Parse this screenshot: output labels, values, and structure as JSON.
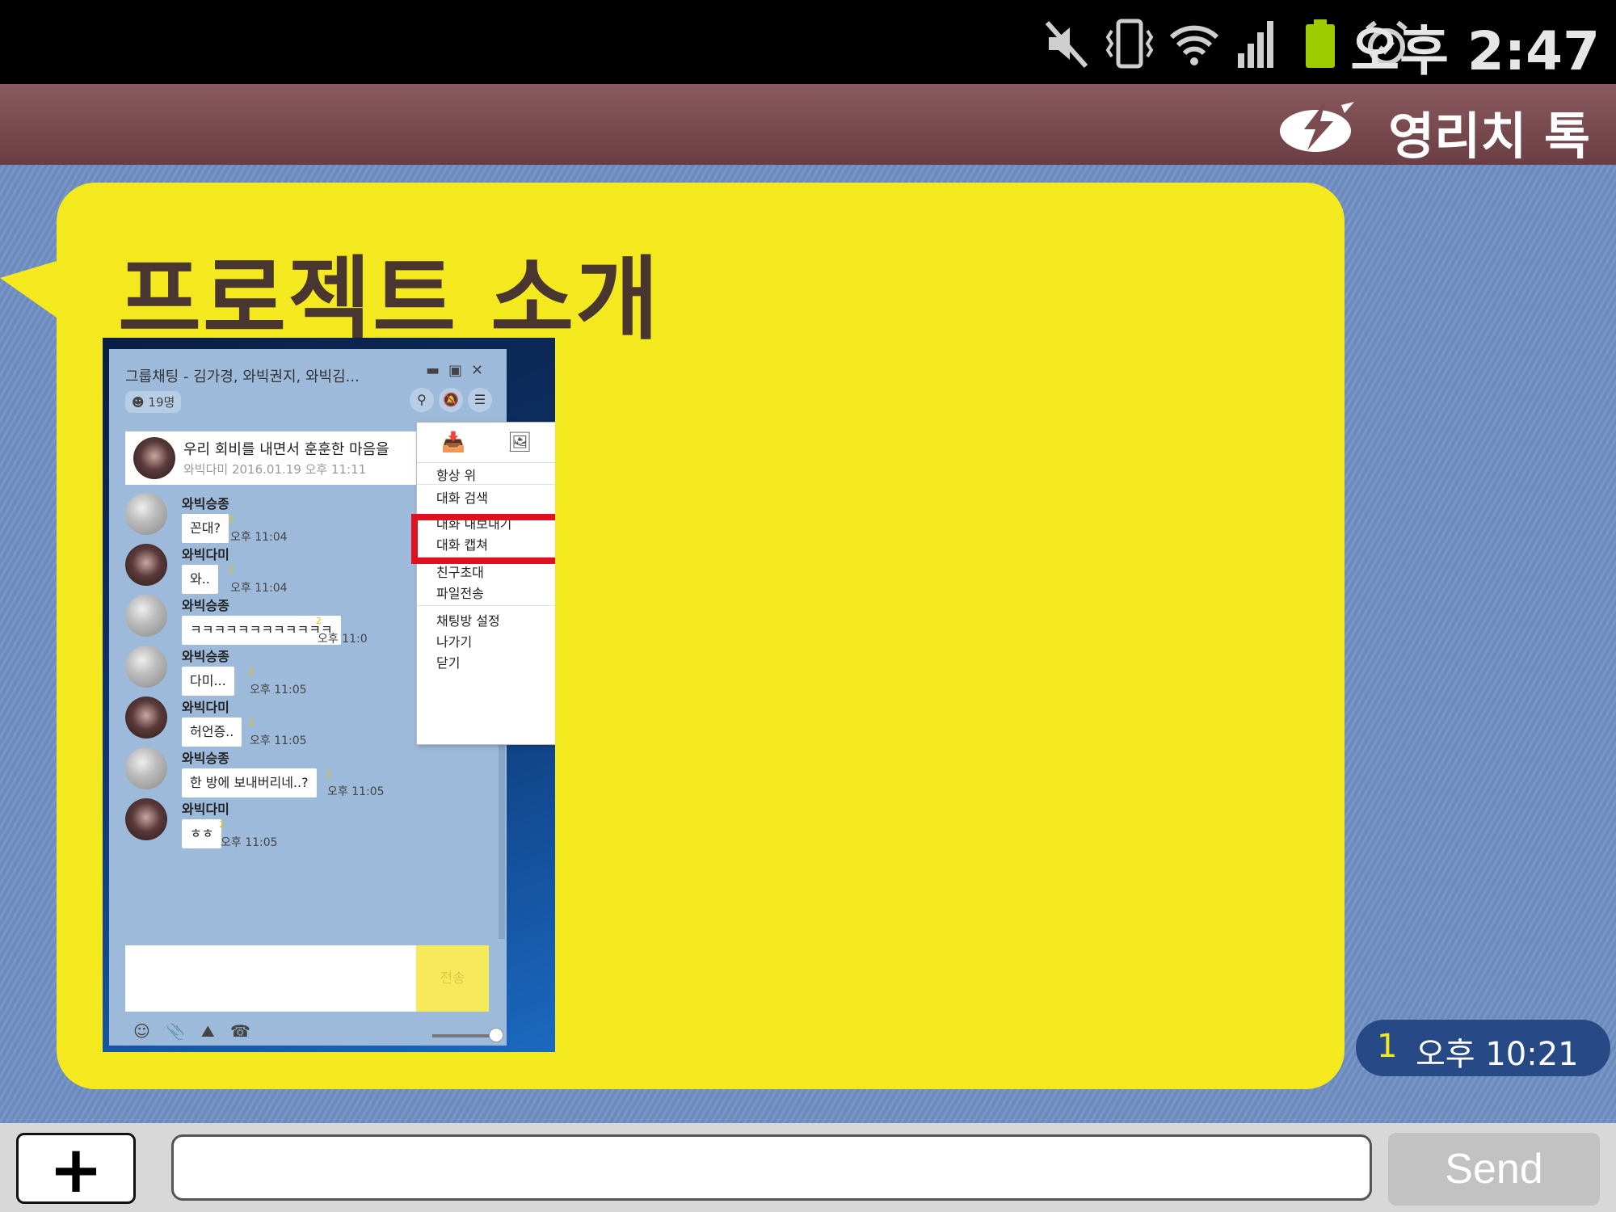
{
  "status_bar": {
    "clock": "오후 2:47",
    "icons": [
      "mute-icon",
      "vibrate-icon",
      "wifi-icon",
      "signal-icon",
      "battery-icon",
      "alarm-icon"
    ]
  },
  "app": {
    "title": "영리치 톡"
  },
  "slide": {
    "title": "프로젝트 소개"
  },
  "chat_window": {
    "title": "그룹채팅 - 김가경, 와빅권지, 와빅김...",
    "member_count": "19명",
    "notice": {
      "text": "우리 회비를 내면서 훈훈한 마음을",
      "sub": "와빅다미  2016.01.19 오후 11:11"
    },
    "messages": [
      {
        "sender": "와빅승종",
        "text": "꼰대?",
        "unread": "2",
        "time": "오후 11:04",
        "avatar": "a"
      },
      {
        "sender": "와빅다미",
        "text": "와..",
        "unread": "2",
        "time": "오후 11:04",
        "avatar": "b"
      },
      {
        "sender": "와빅승종",
        "text": "ㅋㅋㅋㅋㅋㅋㅋㅋㅋㅋㅋㅋ",
        "unread": "2",
        "time": "오후 11:0",
        "avatar": "a"
      },
      {
        "sender": "와빅승종",
        "text": "다미...",
        "unread": "2",
        "time": "오후 11:05",
        "avatar": "a"
      },
      {
        "sender": "와빅다미",
        "text": "허언증..",
        "unread": "2",
        "time": "오후 11:05",
        "avatar": "b"
      },
      {
        "sender": "와빅승종",
        "text": "한 방에 보내버리네..?",
        "unread": "2",
        "time": "오후 11:05",
        "avatar": "a"
      },
      {
        "sender": "와빅다미",
        "text": "ㅎㅎ",
        "unread": "2",
        "time": "오후 11:05",
        "avatar": "b"
      }
    ],
    "send_label": "전송"
  },
  "context_menu": {
    "items": [
      "항상 위",
      "대화 검색",
      "대화 내보내기",
      "대화 캡쳐",
      "친구초대",
      "파일전송",
      "채팅방 설정",
      "나가기",
      "닫기"
    ],
    "highlighted": "대화 내보내기"
  },
  "timestamp": {
    "unread": "1",
    "time": "오후 10:21"
  },
  "bottom_bar": {
    "plus": "+",
    "send": "Send",
    "input_placeholder": ""
  },
  "colors": {
    "bubble": "#f4e81f",
    "header": "#7a4c52",
    "background": "#6f8fc2",
    "highlight": "#e01020"
  }
}
